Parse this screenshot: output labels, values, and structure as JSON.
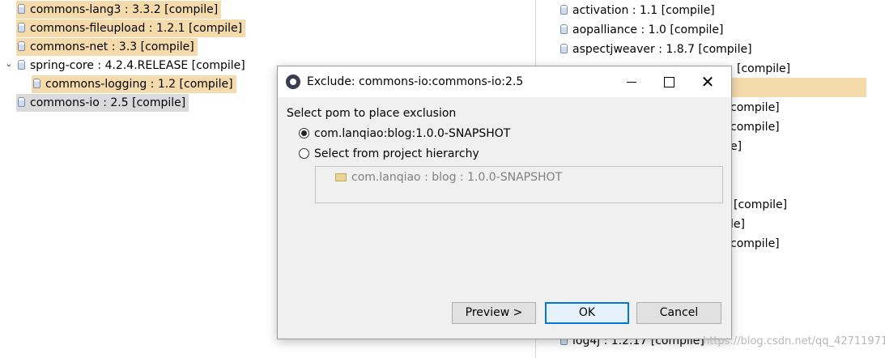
{
  "left_tree": {
    "rows": [
      {
        "label": "commons-lang3 : 3.3.2 [compile]"
      },
      {
        "label": "commons-fileupload : 1.2.1 [compile]"
      },
      {
        "label": "commons-net : 3.3 [compile]"
      },
      {
        "label": "spring-core : 4.2.4.RELEASE [compile]"
      },
      {
        "label": "commons-logging : 1.2 [compile]"
      },
      {
        "label": "commons-io : 2.5 [compile]"
      }
    ],
    "expand_glyph": "⌄"
  },
  "right_list": {
    "rows": [
      {
        "label": "activation : 1.1 [compile]"
      },
      {
        "label": "aopalliance : 1.0 [compile]"
      },
      {
        "label": "aspectjweaver : 1.8.7 [compile]"
      },
      {
        "label": "[compile]"
      },
      {
        "label": "compile]"
      },
      {
        "label": "compile]"
      },
      {
        "label": "e]"
      },
      {
        "label": "[compile]"
      },
      {
        "label": "le]"
      },
      {
        "label": "compile]"
      },
      {
        "label": "log4j : 1.2.17 [compile]"
      }
    ]
  },
  "dialog": {
    "title": "Exclude: commons-io:commons-io:2.5",
    "prompt": "Select pom to place exclusion",
    "option_1": "com.lanqiao:blog:1.0.0-SNAPSHOT",
    "option_2": "Select from project hierarchy",
    "hierarchy_item": "com.lanqiao : blog : 1.0.0-SNAPSHOT",
    "buttons": {
      "preview": "Preview >",
      "ok": "OK",
      "cancel": "Cancel"
    },
    "window_controls": {
      "close_glyph": "✕"
    }
  },
  "watermark": "https://blog.csdn.net/qq_42711971",
  "colors": {
    "highlight": "#f5dbab",
    "selection": "#dadada",
    "default_button_border": "#0078d7"
  }
}
